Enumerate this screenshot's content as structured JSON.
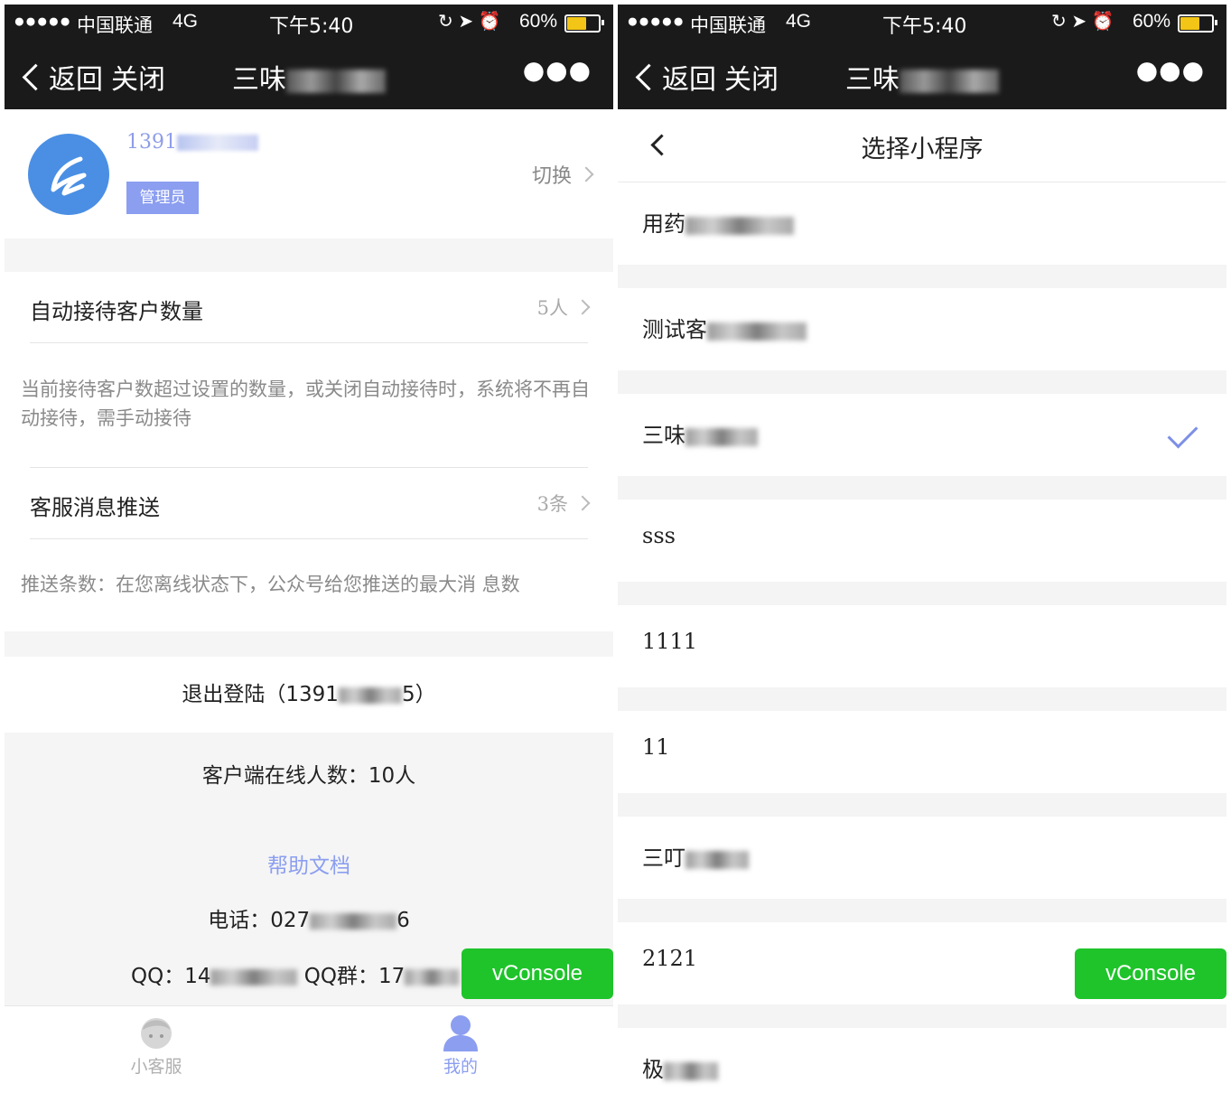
{
  "status_bar": {
    "signal": "●●●●●",
    "carrier": "中国联通",
    "network": "4G",
    "time": "下午5:40",
    "battery": "60%",
    "battery_level": 0.6,
    "battery_color": "#f3c516"
  },
  "nav": {
    "back_label": "返回",
    "close_label": "关闭",
    "title_prefix": "三味",
    "more_label": "●●●"
  },
  "left": {
    "profile": {
      "phone_prefix": "1391",
      "role_badge": "管理员",
      "switch_label": "切换"
    },
    "auto_reception": {
      "label": "自动接待客户数量",
      "value": "5人",
      "description": "当前接待客户数超过设置的数量，或关闭自动接待时，系统将不再自动接待，需手动接待"
    },
    "push": {
      "label": "客服消息推送",
      "value": "3条",
      "description": "推送条数：在您离线状态下，公众号给您推送的最大消 息数"
    },
    "logout": {
      "prefix": "退出登陆（1391",
      "suffix": "5）"
    },
    "footer": {
      "online": "客户端在线人数：10人",
      "help": "帮助文档",
      "tel_prefix": "电话：027",
      "tel_suffix": "6",
      "qq_prefix": "QQ：14",
      "qq_group_prefix": "QQ群：17"
    },
    "tabs": [
      {
        "label": "小客服",
        "active": false
      },
      {
        "label": "我的",
        "active": true
      }
    ]
  },
  "right": {
    "header_title": "选择小程序",
    "items": [
      {
        "text": "用药",
        "blurred": true,
        "selected": false
      },
      {
        "text": "测试客",
        "blurred": true,
        "selected": false
      },
      {
        "text": "三味",
        "blurred": true,
        "selected": true
      },
      {
        "text": "sss",
        "blurred": false,
        "selected": false
      },
      {
        "text": "1111",
        "blurred": false,
        "selected": false
      },
      {
        "text": "11",
        "blurred": false,
        "selected": false
      },
      {
        "text": "三叮",
        "blurred": true,
        "selected": false
      },
      {
        "text": "2121",
        "blurred": false,
        "selected": false
      },
      {
        "text": "极",
        "blurred": true,
        "selected": false
      }
    ]
  },
  "vconsole_label": "vConsole",
  "colors": {
    "accent": "#8b9ef0",
    "avatar": "#4a8fe4",
    "vconsole": "#1fc42b",
    "navbar": "#1a1a1a"
  }
}
